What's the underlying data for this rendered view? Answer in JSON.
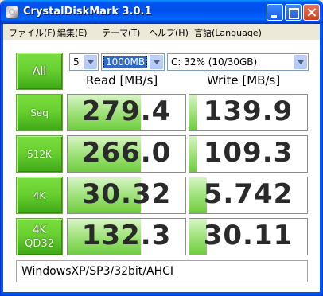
{
  "window": {
    "title": "CrystalDiskMark 3.0.1"
  },
  "menu": {
    "file": "ファイル(F)",
    "edit": "編集(E)",
    "theme": "テーマ(T)",
    "help": "ヘルプ(H)",
    "language": "言語(Language)"
  },
  "controls": {
    "all_label": "All",
    "test_count": "5",
    "test_size": "1000MB",
    "drive": "C: 32% (10/30GB)"
  },
  "headers": {
    "read": "Read [MB/s]",
    "write": "Write [MB/s]"
  },
  "rows": [
    {
      "label": "Seq",
      "read": "279.4",
      "write": "139.9",
      "read_fill": 0.62,
      "write_fill": 0.06
    },
    {
      "label": "512K",
      "read": "266.0",
      "write": "109.3",
      "read_fill": 0.62,
      "write_fill": 0.06
    },
    {
      "label": "4K",
      "read": "30.32",
      "write": "5.742",
      "read_fill": 0.62,
      "write_fill": 0.15
    },
    {
      "label_line1": "4K",
      "label_line2": "QD32",
      "read": "132.3",
      "write": "30.11",
      "read_fill": 0.62,
      "write_fill": 0.15
    }
  ],
  "comment": "WindowsXP/SP3/32bit/AHCI",
  "colors": {
    "titlebar": "#0053ee",
    "button_green": "#6ad032",
    "bar_green": "#9fe27b",
    "background": "#ece9d8"
  },
  "icons": [
    "app-icon",
    "minimize-icon",
    "maximize-icon",
    "close-icon",
    "chevron-down-icon"
  ]
}
